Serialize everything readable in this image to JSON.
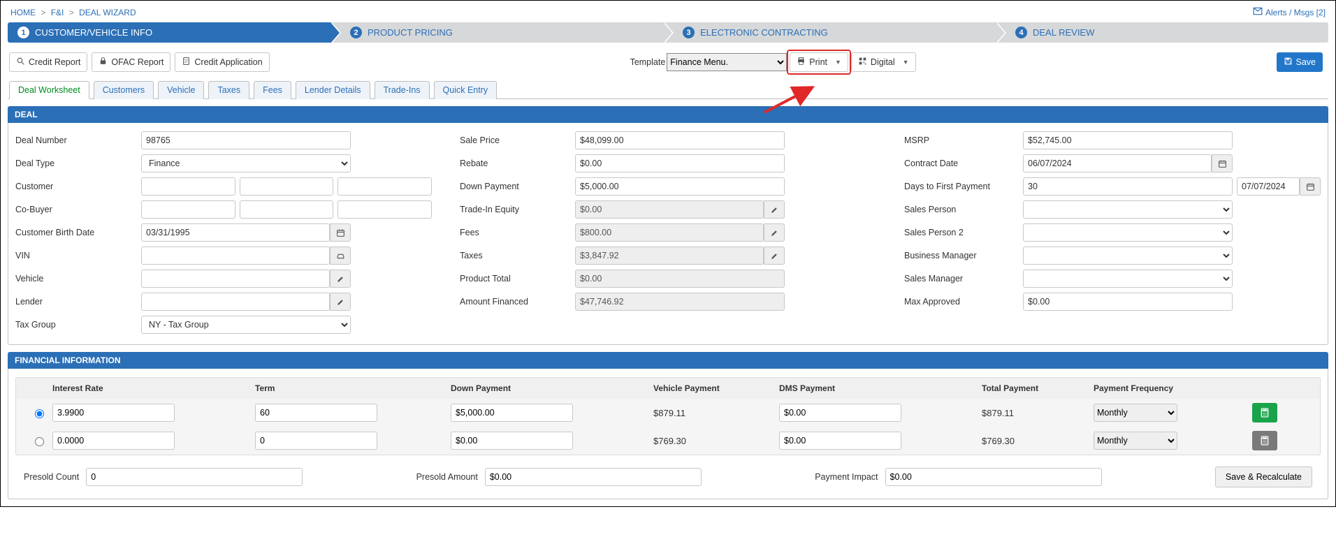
{
  "breadcrumb": {
    "home": "HOME",
    "fni": "F&I",
    "wizard": "DEAL WIZARD"
  },
  "alerts": {
    "label": "Alerts / Msgs [2]"
  },
  "wizard_steps": {
    "s1": {
      "num": "1",
      "label": "CUSTOMER/VEHICLE INFO"
    },
    "s2": {
      "num": "2",
      "label": "PRODUCT PRICING"
    },
    "s3": {
      "num": "3",
      "label": "ELECTRONIC CONTRACTING"
    },
    "s4": {
      "num": "4",
      "label": "DEAL REVIEW"
    }
  },
  "toolbar": {
    "credit_report": "Credit Report",
    "ofac_report": "OFAC Report",
    "credit_app": "Credit Application",
    "template_label": "Template",
    "template_value": "Finance Menu.",
    "print": "Print",
    "digital": "Digital",
    "save": "Save"
  },
  "tabs": {
    "deal_worksheet": "Deal Worksheet",
    "customers": "Customers",
    "vehicle": "Vehicle",
    "taxes": "Taxes",
    "fees": "Fees",
    "lender_details": "Lender Details",
    "trade_ins": "Trade-Ins",
    "quick_entry": "Quick Entry"
  },
  "panels": {
    "deal": "DEAL",
    "fin": "FINANCIAL INFORMATION"
  },
  "deal": {
    "col1": {
      "deal_number": {
        "label": "Deal Number",
        "value": "98765"
      },
      "deal_type": {
        "label": "Deal Type",
        "value": "Finance"
      },
      "customer": {
        "label": "Customer"
      },
      "co_buyer": {
        "label": "Co-Buyer"
      },
      "cust_dob": {
        "label": "Customer Birth Date",
        "value": "03/31/1995"
      },
      "vin": {
        "label": "VIN"
      },
      "vehicle": {
        "label": "Vehicle"
      },
      "lender": {
        "label": "Lender"
      },
      "tax_group": {
        "label": "Tax Group",
        "value": "NY - Tax Group"
      }
    },
    "col2": {
      "sale_price": {
        "label": "Sale Price",
        "value": "$48,099.00"
      },
      "rebate": {
        "label": "Rebate",
        "value": "$0.00"
      },
      "down_payment": {
        "label": "Down Payment",
        "value": "$5,000.00"
      },
      "trade_in_equity": {
        "label": "Trade-In Equity",
        "value": "$0.00"
      },
      "fees": {
        "label": "Fees",
        "value": "$800.00"
      },
      "taxes": {
        "label": "Taxes",
        "value": "$3,847.92"
      },
      "product_total": {
        "label": "Product Total",
        "value": "$0.00"
      },
      "amount_financed": {
        "label": "Amount Financed",
        "value": "$47,746.92"
      }
    },
    "col3": {
      "msrp": {
        "label": "MSRP",
        "value": "$52,745.00"
      },
      "contract_date": {
        "label": "Contract Date",
        "value": "06/07/2024"
      },
      "days_first_pay": {
        "label": "Days to First Payment",
        "days": "30",
        "date": "07/07/2024"
      },
      "sales_person": {
        "label": "Sales Person"
      },
      "sales_person2": {
        "label": "Sales Person 2"
      },
      "business_mgr": {
        "label": "Business Manager"
      },
      "sales_mgr": {
        "label": "Sales Manager"
      },
      "max_approved": {
        "label": "Max Approved",
        "value": "$0.00"
      }
    }
  },
  "fin": {
    "headers": {
      "rate": "Interest Rate",
      "term": "Term",
      "down": "Down Payment",
      "vpay": "Vehicle Payment",
      "dms": "DMS Payment",
      "tot": "Total Payment",
      "freq": "Payment Frequency"
    },
    "rows": [
      {
        "checked": true,
        "rate": "3.9900",
        "term": "60",
        "down": "$5,000.00",
        "vpay": "$879.11",
        "dms": "$0.00",
        "tot": "$879.11",
        "freq": "Monthly"
      },
      {
        "checked": false,
        "rate": "0.0000",
        "term": "0",
        "down": "$0.00",
        "vpay": "$769.30",
        "dms": "$0.00",
        "tot": "$769.30",
        "freq": "Monthly"
      }
    ],
    "presold_count": {
      "label": "Presold Count",
      "value": "0"
    },
    "presold_amount": {
      "label": "Presold Amount",
      "value": "$0.00"
    },
    "payment_impact": {
      "label": "Payment Impact",
      "value": "$0.00"
    },
    "save_recalc": "Save & Recalculate"
  }
}
